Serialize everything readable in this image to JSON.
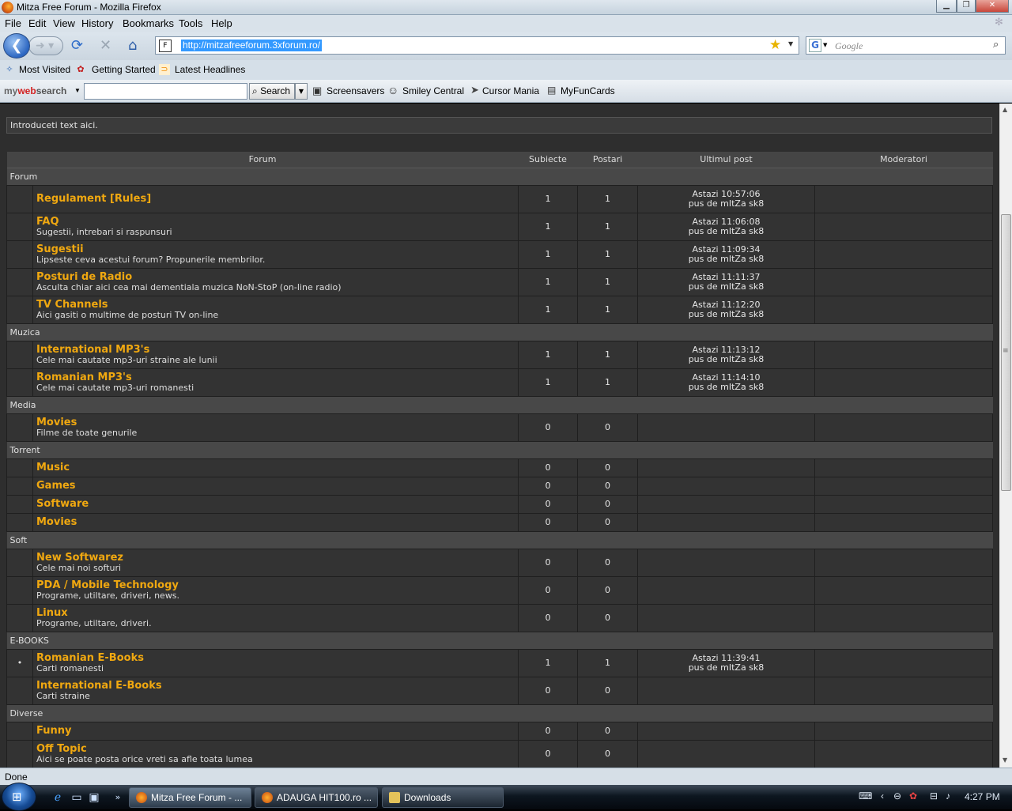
{
  "window": {
    "title": "Mitza Free Forum - Mozilla Firefox"
  },
  "menu": [
    "File",
    "Edit",
    "View",
    "History",
    "Bookmarks",
    "Tools",
    "Help"
  ],
  "nav": {
    "url": "http://mitzafreeforum.3xforum.ro/",
    "search_placeholder": "Google"
  },
  "bookmarks": [
    "Most Visited",
    "Getting Started",
    "Latest Headlines"
  ],
  "toolbar": {
    "brand_my": "my",
    "brand_web": "web",
    "brand_search": "search",
    "search_button": "Search",
    "links": [
      "Screensavers",
      "Smiley Central",
      "Cursor Mania",
      "MyFunCards"
    ]
  },
  "page": {
    "intro": "Introduceti text aici.",
    "headers": {
      "forum": "Forum",
      "topics": "Subiecte",
      "posts": "Postari",
      "last": "Ultimul post",
      "mods": "Moderatori"
    },
    "categories": [
      {
        "name": "Forum",
        "forums": [
          {
            "name": "Regulament [Rules]",
            "desc": "",
            "topics": "1",
            "posts": "1",
            "last_time": "Astazi 10:57:06",
            "last_by": "pus de mItZa sk8"
          },
          {
            "name": "FAQ",
            "desc": "Sugestii, intrebari si raspunsuri",
            "topics": "1",
            "posts": "1",
            "last_time": "Astazi 11:06:08",
            "last_by": "pus de mItZa sk8"
          },
          {
            "name": "Sugestii",
            "desc": "Lipseste ceva acestui forum? Propunerile membrilor.",
            "topics": "1",
            "posts": "1",
            "last_time": "Astazi 11:09:34",
            "last_by": "pus de mItZa sk8"
          },
          {
            "name": "Posturi de Radio",
            "desc": "Asculta chiar aici cea mai dementiala muzica NoN-StoP (on-line radio)",
            "topics": "1",
            "posts": "1",
            "last_time": "Astazi 11:11:37",
            "last_by": "pus de mItZa sk8"
          },
          {
            "name": "TV Channels",
            "desc": "Aici gasiti o multime de posturi TV on-line",
            "topics": "1",
            "posts": "1",
            "last_time": "Astazi 11:12:20",
            "last_by": "pus de mItZa sk8"
          }
        ]
      },
      {
        "name": "Muzica",
        "forums": [
          {
            "name": "International MP3's",
            "desc": "Cele mai cautate mp3-uri straine ale lunii",
            "topics": "1",
            "posts": "1",
            "last_time": "Astazi 11:13:12",
            "last_by": "pus de mItZa sk8"
          },
          {
            "name": "Romanian MP3's",
            "desc": "Cele mai cautate mp3-uri romanesti",
            "topics": "1",
            "posts": "1",
            "last_time": "Astazi 11:14:10",
            "last_by": "pus de mItZa sk8"
          }
        ]
      },
      {
        "name": "Media",
        "forums": [
          {
            "name": "Movies",
            "desc": "Filme de toate genurile",
            "topics": "0",
            "posts": "0",
            "last_time": "",
            "last_by": ""
          }
        ]
      },
      {
        "name": "Torrent",
        "forums": [
          {
            "name": "Music",
            "desc": "",
            "topics": "0",
            "posts": "0",
            "last_time": "",
            "last_by": ""
          },
          {
            "name": "Games",
            "desc": "",
            "topics": "0",
            "posts": "0",
            "last_time": "",
            "last_by": ""
          },
          {
            "name": "Software",
            "desc": "",
            "topics": "0",
            "posts": "0",
            "last_time": "",
            "last_by": ""
          },
          {
            "name": "Movies",
            "desc": "",
            "topics": "0",
            "posts": "0",
            "last_time": "",
            "last_by": ""
          }
        ]
      },
      {
        "name": "Soft",
        "forums": [
          {
            "name": "New Softwarez",
            "desc": "Cele mai noi softuri",
            "topics": "0",
            "posts": "0",
            "last_time": "",
            "last_by": ""
          },
          {
            "name": "PDA / Mobile Technology",
            "desc": "Programe, utiltare, driveri, news.",
            "topics": "0",
            "posts": "0",
            "last_time": "",
            "last_by": ""
          },
          {
            "name": "Linux",
            "desc": "Programe, utiltare, driveri.",
            "topics": "0",
            "posts": "0",
            "last_time": "",
            "last_by": ""
          }
        ]
      },
      {
        "name": "E-BOOKS",
        "forums": [
          {
            "name": "Romanian E-Books",
            "desc": "Carti romanesti",
            "topics": "1",
            "posts": "1",
            "last_time": "Astazi 11:39:41",
            "last_by": "pus de mItZa sk8",
            "new_icon": "•"
          },
          {
            "name": "International E-Books",
            "desc": "Carti straine",
            "topics": "0",
            "posts": "0",
            "last_time": "",
            "last_by": ""
          }
        ]
      },
      {
        "name": "Diverse",
        "forums": [
          {
            "name": "Funny",
            "desc": "",
            "topics": "0",
            "posts": "0",
            "last_time": "",
            "last_by": ""
          },
          {
            "name": "Off Topic",
            "desc": "Aici se poate posta orice vreti sa afle toata lumea",
            "topics": "0",
            "posts": "0",
            "last_time": "",
            "last_by": ""
          }
        ]
      }
    ]
  },
  "status": "Done",
  "taskbar": {
    "items": [
      "Mitza Free Forum - ...",
      "ADAUGA HIT100.ro ...",
      "Downloads"
    ],
    "clock": "4:27 PM"
  }
}
